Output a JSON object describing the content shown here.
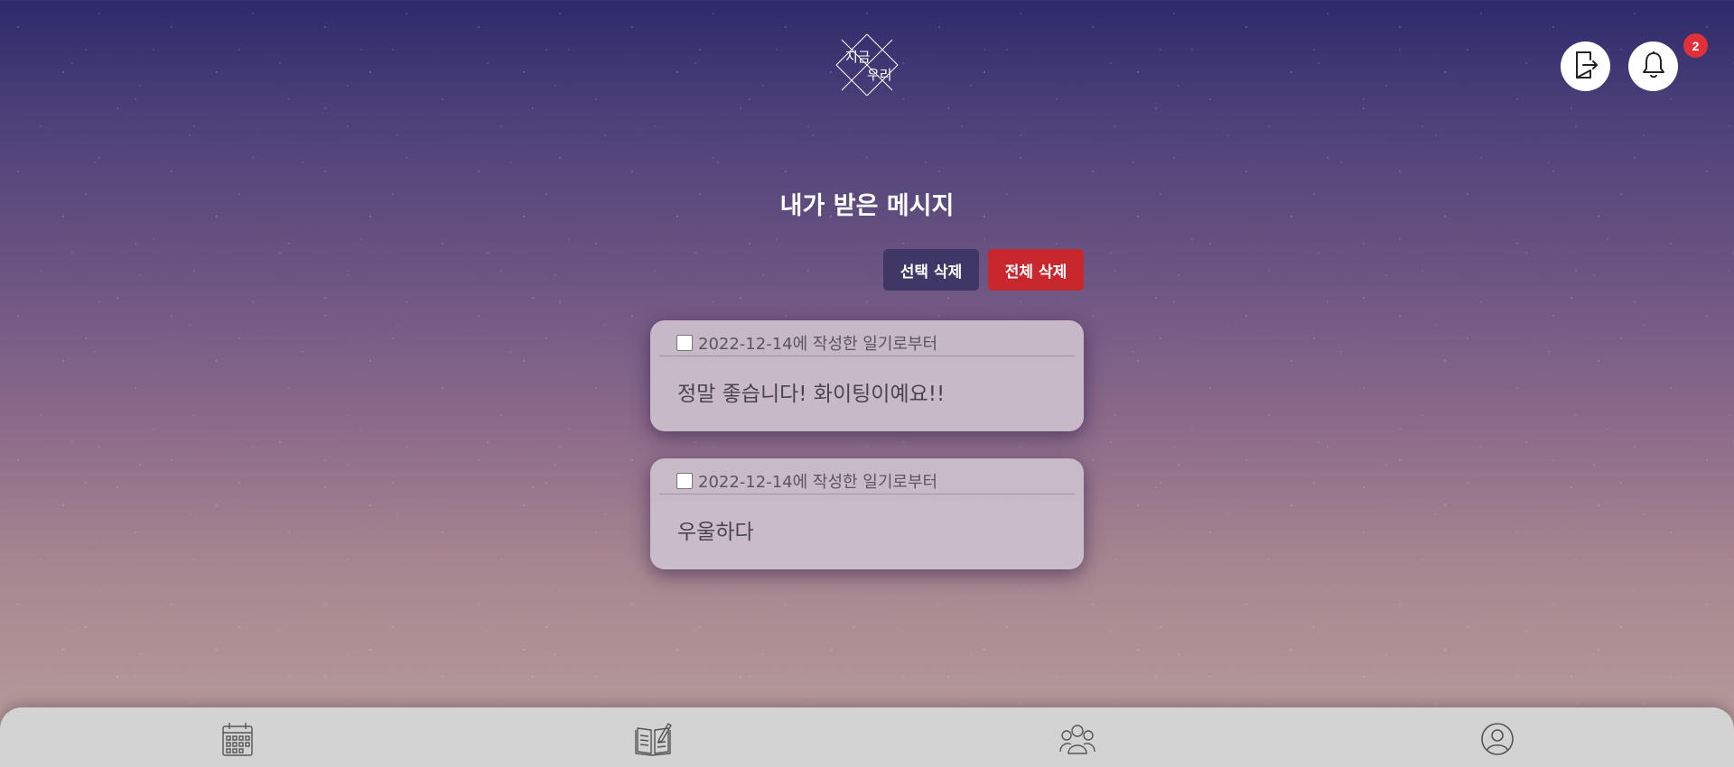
{
  "app": {
    "logo_text": "지금 우리"
  },
  "header": {
    "logout_icon": "logout-icon",
    "bell_icon": "bell-icon",
    "notification_count": "2"
  },
  "page": {
    "title": "내가 받은 메시지"
  },
  "actions": {
    "select_delete_label": "선택 삭제",
    "delete_all_label": "전체 삭제"
  },
  "messages": [
    {
      "date_label": "2022-12-14에 작성한 일기로부터",
      "text": "정말 좋습니다! 화이팅이예요!!",
      "checked": false
    },
    {
      "date_label": "2022-12-14에 작성한 일기로부터",
      "text": "우울하다",
      "checked": false
    }
  ],
  "bottom_nav": [
    {
      "icon": "calendar-icon"
    },
    {
      "icon": "diary-icon"
    },
    {
      "icon": "friends-icon"
    },
    {
      "icon": "profile-icon"
    }
  ],
  "colors": {
    "select_delete_bg": "#3f3766",
    "delete_all_bg": "#c8282d",
    "badge_bg": "#e0303a"
  }
}
